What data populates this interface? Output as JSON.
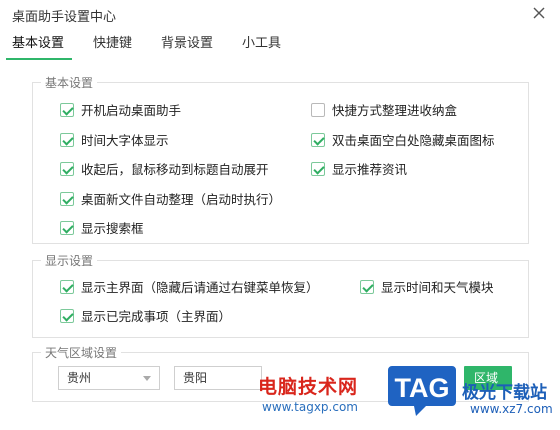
{
  "window": {
    "title": "桌面助手设置中心"
  },
  "tabs": [
    {
      "label": "基本设置",
      "active": true
    },
    {
      "label": "快捷键",
      "active": false
    },
    {
      "label": "背景设置",
      "active": false
    },
    {
      "label": "小工具",
      "active": false
    }
  ],
  "basic": {
    "legend": "基本设置",
    "items": [
      {
        "label": "开机启动桌面助手",
        "checked": true
      },
      {
        "label": "快捷方式整理进收纳盒",
        "checked": false
      },
      {
        "label": "时间大字体显示",
        "checked": true
      },
      {
        "label": "双击桌面空白处隐藏桌面图标",
        "checked": true
      },
      {
        "label": "收起后，鼠标移动到标题自动展开",
        "checked": true
      },
      {
        "label": "显示推荐资讯",
        "checked": true
      },
      {
        "label": "桌面新文件自动整理（启动时执行）",
        "checked": true
      },
      {
        "label": "显示搜索框",
        "checked": true
      }
    ]
  },
  "display": {
    "legend": "显示设置",
    "items": [
      {
        "label": "显示主界面（隐藏后请通过右键菜单恢复）",
        "checked": true
      },
      {
        "label": "显示时间和天气模块",
        "checked": true
      },
      {
        "label": "显示已完成事项（主界面）",
        "checked": true
      }
    ]
  },
  "weather": {
    "legend": "天气区域设置",
    "province": "贵州",
    "city": "贵阳",
    "button_label": "区域"
  },
  "watermark": {
    "brand": "电脑技术网",
    "url": "www.tagxp.com",
    "logo_text": "TAG",
    "site": "极光下载站",
    "site_url": "www.xz7.com"
  },
  "colors": {
    "accent": "#2fb66a",
    "watermark_red": "#d9261c",
    "watermark_blue": "#1d5fb8"
  }
}
